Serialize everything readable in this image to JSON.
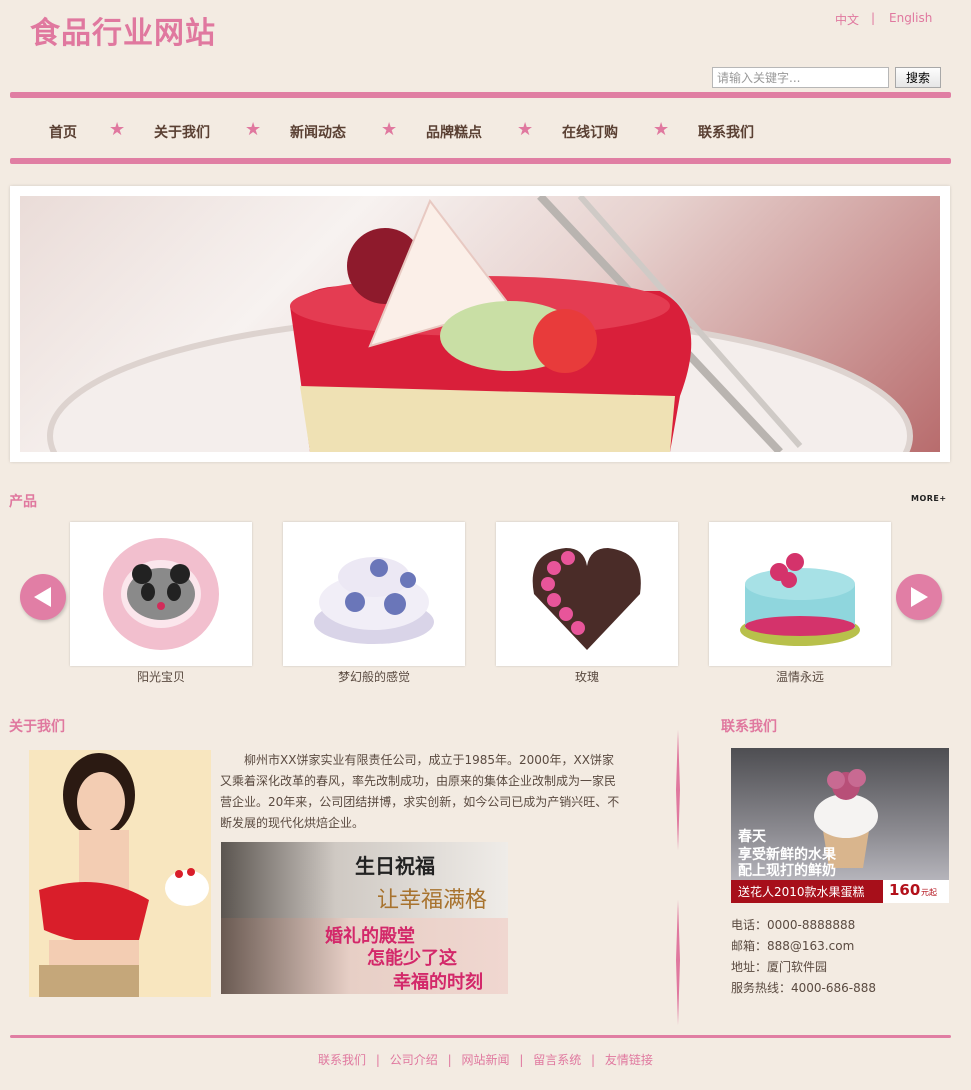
{
  "header": {
    "logo_text": "食品行业网站",
    "lang_cn": "中文",
    "lang_sep": "|",
    "lang_en": "English",
    "search_placeholder": "请输入关键字...",
    "search_button": "搜索"
  },
  "nav": {
    "items": [
      {
        "label": "首页"
      },
      {
        "label": "关于我们"
      },
      {
        "label": "新闻动态"
      },
      {
        "label": "品牌糕点"
      },
      {
        "label": "在线订购"
      },
      {
        "label": "联系我们"
      }
    ],
    "separator_icon": "star-icon"
  },
  "products": {
    "title": "产品",
    "more_label": "MORE+",
    "items": [
      {
        "name": "阳光宝贝"
      },
      {
        "name": "梦幻般的感觉"
      },
      {
        "name": "玫瑰"
      },
      {
        "name": "温情永远"
      }
    ]
  },
  "about": {
    "title": "关于我们",
    "text": "柳州市XX饼家实业有限责任公司，成立于1985年。2000年，XX饼家又乘着深化改革的春风，率先改制成功，由原来的集体企业改制成为一家民营企业。20年来，公司团结拼博，求实创新，如今公司已成为产销兴旺、不断发展的现代化烘焙企业。",
    "promo_birthday_title": "生日祝福",
    "promo_birthday_sub": "让幸福满格",
    "promo_wedding_line1": "婚礼的殿堂",
    "promo_wedding_line2": "怎能少了这",
    "promo_wedding_line3": "幸福的时刻"
  },
  "contact": {
    "title": "联系我们",
    "promo_line1": "春天",
    "promo_line2": "享受新鲜的水果",
    "promo_line3": "配上现打的鲜奶",
    "promo_caption": "送花人2010款水果蛋糕",
    "promo_price": "160",
    "promo_unit": "元起",
    "phone": "电话：0000-8888888",
    "email": "邮箱：888@163.com",
    "address": "地址：厦门软件园",
    "hotline": "服务热线：4000-686-888"
  },
  "footer": {
    "links": [
      "联系我们",
      "公司介绍",
      "网站新闻",
      "留言系统",
      "友情链接"
    ],
    "separator": "|"
  },
  "colors": {
    "accent": "#e0789f",
    "background": "#f3ebe2",
    "nav_text": "#5a4033"
  }
}
